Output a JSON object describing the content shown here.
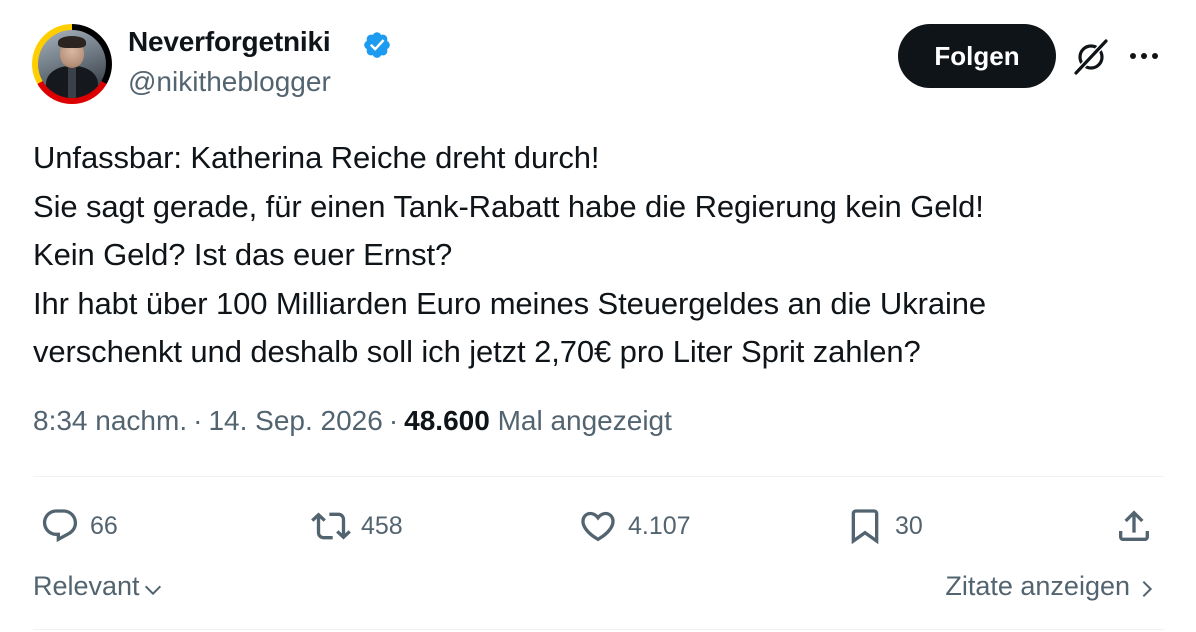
{
  "author": {
    "display_name": "Neverforgetniki",
    "handle": "@nikitheblogger",
    "verified": true,
    "avatar_icon": "profile-photo-with-german-flag-ring"
  },
  "header": {
    "follow_label": "Folgen",
    "grok_icon": "grok-icon",
    "more_icon": "more-dots-icon"
  },
  "tweet": {
    "lines": [
      "Unfassbar: Katherina Reiche dreht durch!",
      "Sie sagt gerade, für einen Tank-Rabatt habe die Regierung kein Geld!",
      "Kein Geld? Ist das euer Ernst?",
      "Ihr habt über 100 Milliarden Euro meines Steuergeldes an die Ukraine",
      "verschenkt und deshalb soll ich jetzt 2,70€ pro Liter Sprit zahlen?"
    ]
  },
  "meta": {
    "time": "8:34 nachm.",
    "separator": "·",
    "date": "14. Sep. 2026",
    "views": "48.600",
    "views_label": "Mal angezeigt"
  },
  "actions": {
    "replies": "66",
    "reposts": "458",
    "likes": "4.107",
    "bookmarks": "30"
  },
  "footer": {
    "sort_label": "Relevant",
    "quotes_label": "Zitate anzeigen"
  },
  "colors": {
    "text": "#0f1419",
    "secondary": "#536471",
    "verified_blue": "#1d9bf0",
    "divider": "#eff3f4"
  }
}
